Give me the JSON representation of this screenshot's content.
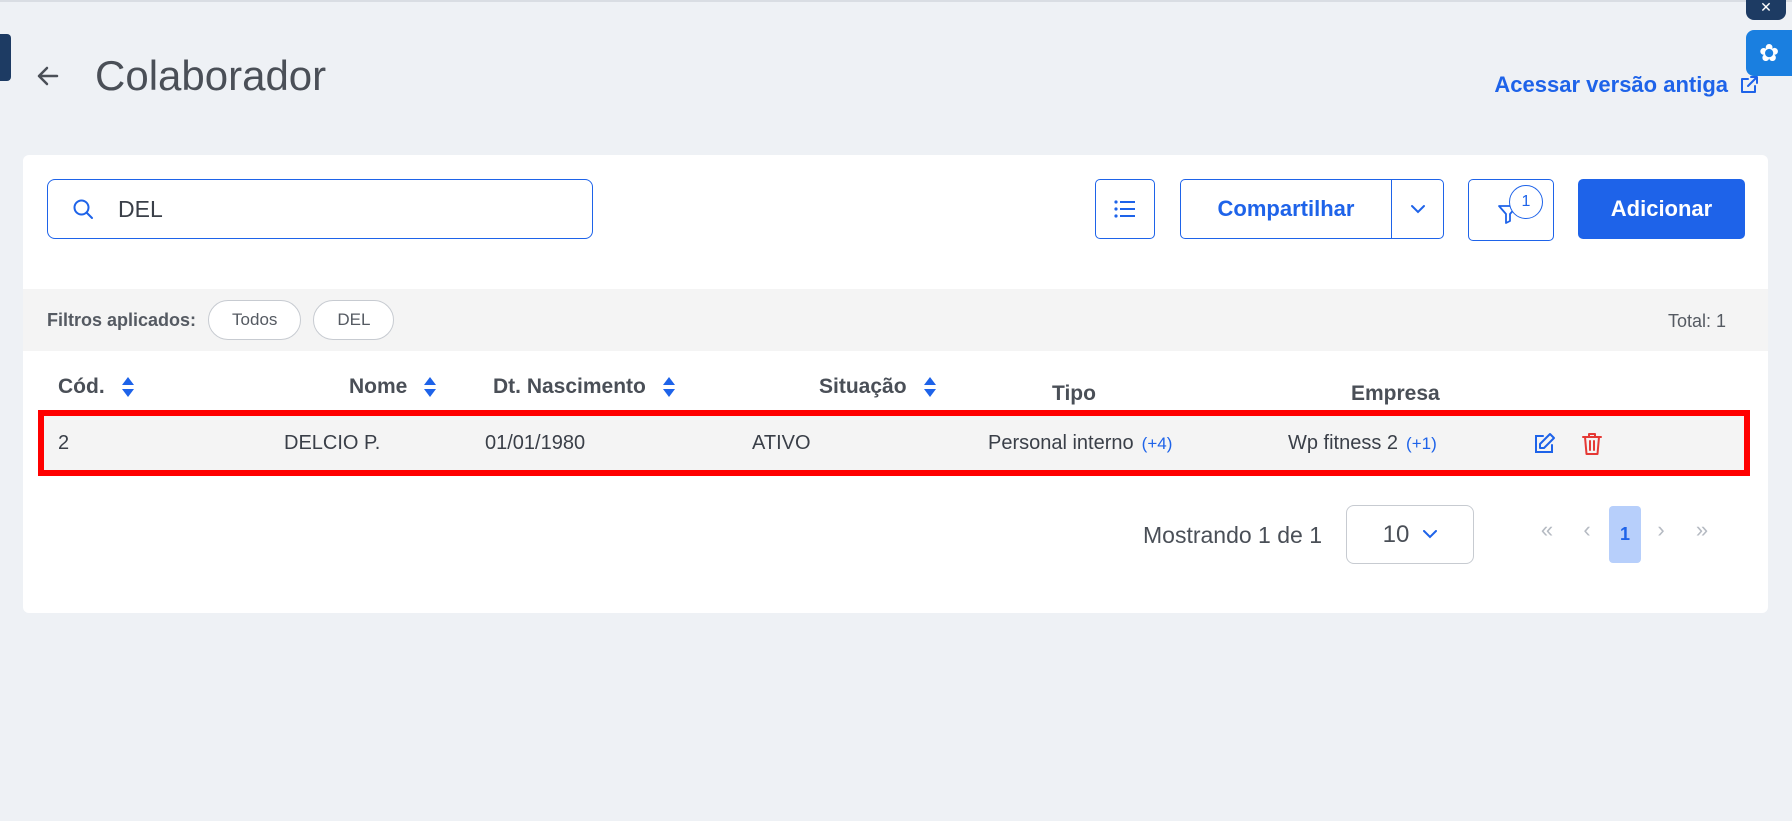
{
  "header": {
    "title": "Colaborador",
    "old_version_link": "Acessar versão antiga"
  },
  "toolbar": {
    "search_value": "DEL",
    "share_label": "Compartilhar",
    "filter_count": "1",
    "add_label": "Adicionar"
  },
  "filters": {
    "label": "Filtros aplicados:",
    "chips": [
      "Todos",
      "DEL"
    ],
    "total": "Total: 1"
  },
  "table": {
    "columns": {
      "cod": "Cód.",
      "nome": "Nome",
      "nascimento": "Dt. Nascimento",
      "situacao": "Situação",
      "tipo": "Tipo",
      "empresa": "Empresa"
    },
    "rows": [
      {
        "cod": "2",
        "nome": "DELCIO P.",
        "nascimento": "01/01/1980",
        "situacao": "ATIVO",
        "tipo": "Personal interno",
        "tipo_more": "(+4)",
        "empresa": "Wp fitness 2",
        "empresa_more": "(+1)"
      }
    ]
  },
  "pagination": {
    "showing": "Mostrando 1 de 1",
    "page_size": "10",
    "current_page": "1"
  },
  "colors": {
    "primary": "#1e63e9",
    "danger": "#e53935",
    "highlight": "#ff0000"
  }
}
